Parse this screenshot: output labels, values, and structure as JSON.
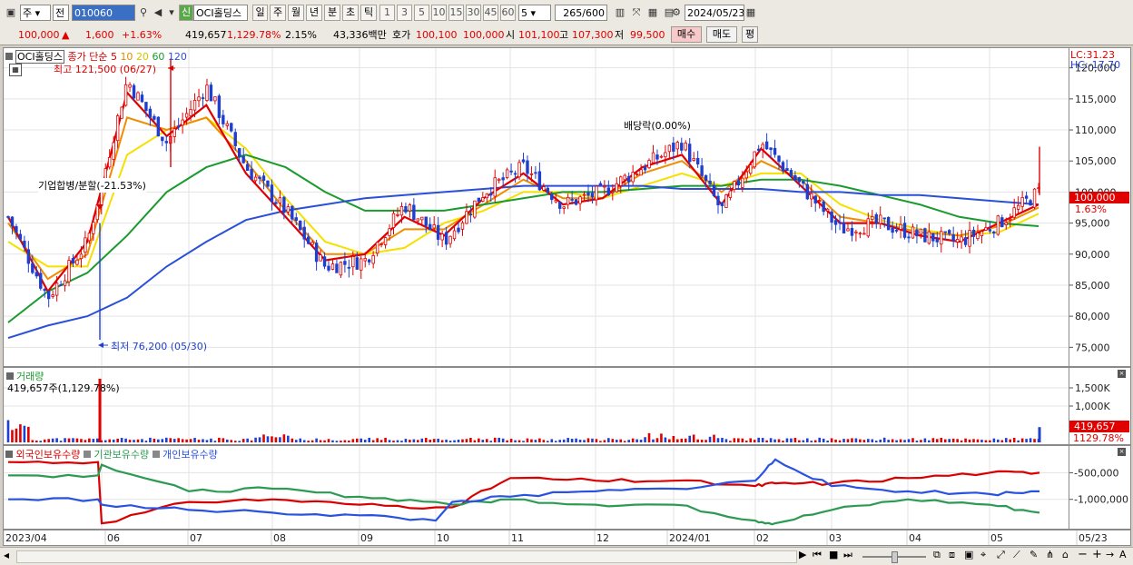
{
  "toolbar": {
    "market_type": "주",
    "all_label": "전",
    "code": "010060",
    "stock_name": "OCI홀딩스",
    "credit_badge": "신",
    "periods": [
      "일",
      "주",
      "월",
      "년",
      "분",
      "초",
      "틱"
    ],
    "selected_period": "일",
    "intervals": [
      "1",
      "3",
      "5",
      "10",
      "15",
      "30",
      "45",
      "60"
    ],
    "interval_value": "5",
    "count_display": "265",
    "count_total": "/600",
    "date": "2024/05/23"
  },
  "quote": {
    "price": "100,000",
    "change_arrow": "▲",
    "change": "1,600",
    "change_pct": "+1.63%",
    "volume": "419,657",
    "volume_ratio": "1,129.78%",
    "turnover": "2.15%",
    "amount": "43,336백만",
    "ask_label": "호가",
    "ask_value": "100,100",
    "bid_value": "100,000",
    "open_label": "시",
    "open": "101,100",
    "high_label": "고",
    "high": "107,300",
    "low_label": "저",
    "low": "99,500",
    "buy_button": "매수",
    "sell_button": "매도",
    "eval_button": "평"
  },
  "price_panel": {
    "title": "OCI홀딩스",
    "legend_prefix": "종가 단순",
    "ma_labels": [
      "5",
      "10",
      "20",
      "60",
      "120"
    ],
    "max_label": "최고 121,500 (06/27)",
    "min_label": "최저 76,200 (05/30)",
    "event_merge": "기업합병/분할(-21.53%)",
    "event_dividend": "배당락(0.00%)",
    "lc_label": "LC:31.23",
    "hc_label": "HC:-17.70",
    "last_price_tag": "100,000",
    "last_change_tag": "1.63%"
  },
  "volume_panel": {
    "title": "거래량",
    "info": "419,657주(1,129.78%)",
    "last_tag": "419,657",
    "last_ratio_tag": "1129.78%"
  },
  "holdings_panel": {
    "legend": [
      "외국인보유수량",
      "기관보유수량",
      "개인보유수량"
    ]
  },
  "x_axis_labels": [
    "2023/04",
    "06",
    "07",
    "08",
    "09",
    "10",
    "11",
    "12",
    "2024/01",
    "02",
    "03",
    "04",
    "05",
    "05/23"
  ],
  "colors": {
    "up": "#e00000",
    "down": "#1f3fd0",
    "ma5": "#e00000",
    "ma10": "#f08c00",
    "ma20": "#f5e000",
    "ma60": "#1b9a2e",
    "ma120": "#2a4fd8",
    "foreign": "#d80000",
    "institution": "#2c9a52",
    "individual": "#2a52e0"
  },
  "chart_data": [
    {
      "type": "candlestick",
      "title": "OCI홀딩스 종가 단순 이동평균 5 10 20 60 120",
      "y_ticks": [
        "120,000",
        "115,000",
        "110,000",
        "105,000",
        "100,000",
        "95,000",
        "90,000",
        "85,000",
        "80,000",
        "75,000"
      ],
      "ylim": [
        73000,
        122000
      ],
      "x": [
        "2023/04",
        "05",
        "06",
        "07",
        "08",
        "09",
        "10",
        "11",
        "12",
        "2024/01",
        "02",
        "03",
        "04",
        "05",
        "05/23"
      ],
      "close_path": [
        [
          "2023/04",
          96000
        ],
        [
          "05/30",
          83000
        ],
        [
          "06",
          92000
        ],
        [
          "06/27",
          118000
        ],
        [
          "07",
          108000
        ],
        [
          "07/15",
          117000
        ],
        [
          "08",
          104000
        ],
        [
          "08/15",
          97000
        ],
        [
          "09",
          88000
        ],
        [
          "09/20",
          89000
        ],
        [
          "10",
          98000
        ],
        [
          "10/20",
          92000
        ],
        [
          "11",
          100000
        ],
        [
          "11/20",
          104000
        ],
        [
          "12",
          98000
        ],
        [
          "12/20",
          100000
        ],
        [
          "2024/01",
          104000
        ],
        [
          "01/10",
          108000
        ],
        [
          "01/25",
          97000
        ],
        [
          "02",
          108000
        ],
        [
          "02/15",
          101000
        ],
        [
          "03",
          94000
        ],
        [
          "03/20",
          95000
        ],
        [
          "04",
          93000
        ],
        [
          "04/20",
          92000
        ],
        [
          "05",
          95000
        ],
        [
          "05/23",
          100000
        ]
      ],
      "high": 121500,
      "low": 76200,
      "last": 100000,
      "series": [
        {
          "name": "5",
          "values": [
            96000,
            84000,
            92000,
            116000,
            109000,
            114000,
            103000,
            96000,
            89000,
            90000,
            96000,
            93000,
            99000,
            103000,
            98000,
            99000,
            104000,
            106000,
            98000,
            107000,
            101000,
            95000,
            95000,
            93000,
            92000,
            95000,
            98000
          ]
        },
        {
          "name": "10",
          "values": [
            95000,
            86000,
            90000,
            112000,
            110000,
            112000,
            105000,
            97000,
            90000,
            90000,
            94000,
            94000,
            98000,
            102000,
            99000,
            99000,
            103000,
            105000,
            100000,
            105000,
            102000,
            96000,
            95000,
            93500,
            93000,
            94500,
            97500
          ]
        },
        {
          "name": "20",
          "values": [
            92000,
            88000,
            88000,
            106000,
            110000,
            112000,
            107000,
            99000,
            92000,
            90000,
            91000,
            95000,
            97000,
            100000,
            100000,
            99000,
            101000,
            103000,
            101000,
            103000,
            103000,
            98000,
            95500,
            94000,
            93000,
            93500,
            96500
          ]
        },
        {
          "name": "60",
          "values": [
            79000,
            84000,
            87000,
            93000,
            100000,
            104000,
            106000,
            104000,
            100000,
            97000,
            97000,
            97000,
            98000,
            99000,
            100000,
            100000,
            100500,
            101000,
            101000,
            102000,
            102000,
            101000,
            99500,
            98000,
            96000,
            95000,
            94500
          ]
        },
        {
          "name": "120",
          "values": [
            76500,
            78500,
            80000,
            83000,
            88000,
            92000,
            95500,
            97000,
            98000,
            99000,
            99500,
            100000,
            100500,
            101000,
            101000,
            101000,
            101000,
            100500,
            100500,
            100500,
            100000,
            100000,
            99500,
            99500,
            99000,
            98500,
            98000
          ]
        }
      ]
    },
    {
      "type": "bar",
      "title": "거래량",
      "y_ticks": [
        "1,500K",
        "1,000K"
      ],
      "ylim": [
        0,
        1800000
      ],
      "last": 419657,
      "notable": [
        {
          "x": "05/30",
          "value": 1750000
        },
        {
          "x": "2023/04",
          "value": 650000
        },
        {
          "x": "01/10",
          "value": 380000
        },
        {
          "x": "05/23",
          "value": 419657
        }
      ]
    },
    {
      "type": "line",
      "title": "보유수량",
      "y_ticks": [
        "-500,000",
        "-1,000,000"
      ],
      "ylim": [
        -1500000,
        -100000
      ],
      "x": [
        "2023/04",
        "05/30",
        "06",
        "07",
        "08",
        "09",
        "10",
        "10/10",
        "11",
        "12",
        "2024/01",
        "02",
        "02/20",
        "03",
        "04",
        "05",
        "05/23"
      ],
      "series": [
        {
          "name": "외국인보유수량",
          "values": [
            -300000,
            -300000,
            -1450000,
            -1050000,
            -1000000,
            -1100000,
            -1150000,
            -1150000,
            -600000,
            -650000,
            -650000,
            -750000,
            -700000,
            -700000,
            -600000,
            -500000,
            -500000
          ]
        },
        {
          "name": "기관보유수량",
          "values": [
            -550000,
            -550000,
            -350000,
            -850000,
            -800000,
            -950000,
            -1050000,
            -1100000,
            -1000000,
            -1100000,
            -1100000,
            -1400000,
            -1450000,
            -1200000,
            -1000000,
            -1100000,
            -1250000
          ]
        },
        {
          "name": "개인보유수량",
          "values": [
            -1000000,
            -1000000,
            -1100000,
            -1200000,
            -1250000,
            -1300000,
            -1400000,
            -1050000,
            -950000,
            -850000,
            -800000,
            -650000,
            -250000,
            -750000,
            -850000,
            -900000,
            -850000
          ]
        }
      ]
    }
  ]
}
